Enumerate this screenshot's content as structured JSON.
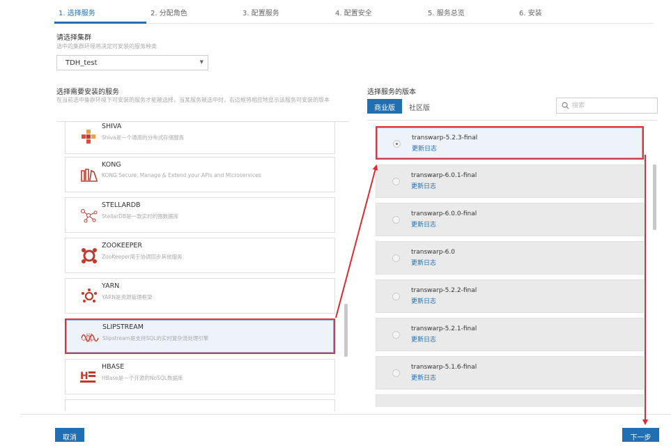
{
  "steps": [
    "1. 选择服务",
    "2. 分配角色",
    "3. 配置服务",
    "4. 配置安全",
    "5. 服务总览",
    "6. 安装"
  ],
  "cluster": {
    "title": "请选择集群",
    "subtitle": "选中的集群环境将决定可安装的服务种类",
    "selected": "TDH_test"
  },
  "services_section": {
    "title": "选择需要安装的服务",
    "subtitle": "在当前选中集群环境下可安装的服务才能被选择，当某服务被选中时，右边框将相应地显示该服务可安装的版本"
  },
  "services": [
    {
      "name": "SHIVA",
      "desc": "Shiva是一个通用的分布式存储服务",
      "icon": "shiva-icon",
      "color": "#e04a3f"
    },
    {
      "name": "KONG",
      "desc": "KONG Secure, Manage & Extend your APIs and Microservices",
      "icon": "kong-icon",
      "color": "#d9534f"
    },
    {
      "name": "STELLARDB",
      "desc": "StellarDB是一款实时的图数据库",
      "icon": "stellardb-icon",
      "color": "#d9534f"
    },
    {
      "name": "ZOOKEEPER",
      "desc": "ZooKeeper用于协调同步其他服务",
      "icon": "zookeeper-icon",
      "color": "#d9534f"
    },
    {
      "name": "YARN",
      "desc": "YARN是资源管理框架",
      "icon": "yarn-icon",
      "color": "#d9534f"
    },
    {
      "name": "SLIPSTREAM",
      "desc": "Slipstream是支持SQL的实时复杂流处理引擎",
      "icon": "slipstream-icon",
      "color": "#d9534f"
    },
    {
      "name": "HBASE",
      "desc": "HBase是一个开源的NoSQL数据库",
      "icon": "hbase-icon",
      "color": "#d9534f"
    }
  ],
  "versions_section": {
    "title": "选择服务的版本",
    "tab_commercial": "商业版",
    "tab_community": "社区版",
    "search_placeholder": "搜索"
  },
  "versions": [
    {
      "name": "transwarp-5.2.3-final",
      "log": "更新日志"
    },
    {
      "name": "transwarp-6.0.1-final",
      "log": "更新日志"
    },
    {
      "name": "transwarp-6.0.0-final",
      "log": "更新日志"
    },
    {
      "name": "transwarp-6.0",
      "log": "更新日志"
    },
    {
      "name": "transwarp-5.2.2-final",
      "log": "更新日志"
    },
    {
      "name": "transwarp-5.2.1-final",
      "log": "更新日志"
    },
    {
      "name": "transwarp-5.1.6-final",
      "log": "更新日志"
    }
  ],
  "footer": {
    "cancel": "取消",
    "next": "下一步"
  },
  "colors": {
    "accent": "#1f6fb2",
    "highlight": "#d9363e"
  }
}
